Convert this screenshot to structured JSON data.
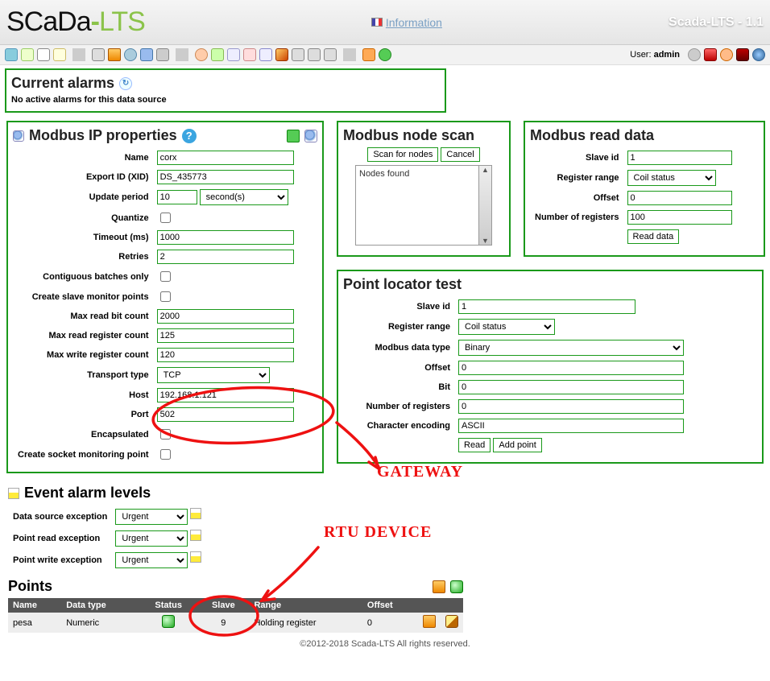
{
  "header": {
    "logo_pre": "SCaDa",
    "logo_post": "LTS",
    "info_link": "Information",
    "version": "Scada-LTS - 1.1",
    "user_label": "User:",
    "user_name": "admin"
  },
  "alarms": {
    "title": "Current alarms",
    "message": "No active alarms for this data source"
  },
  "modbus_props": {
    "title": "Modbus IP properties",
    "fields": {
      "name_l": "Name",
      "name_v": "corx",
      "xid_l": "Export ID (XID)",
      "xid_v": "DS_435773",
      "period_l": "Update period",
      "period_v": "10",
      "period_unit": "second(s)",
      "quantize_l": "Quantize",
      "timeout_l": "Timeout (ms)",
      "timeout_v": "1000",
      "retries_l": "Retries",
      "retries_v": "2",
      "cbatches_l": "Contiguous batches only",
      "csmp_l": "Create slave monitor points",
      "mrbit_l": "Max read bit count",
      "mrbit_v": "2000",
      "mrreg_l": "Max read register count",
      "mrreg_v": "125",
      "mwreg_l": "Max write register count",
      "mwreg_v": "120",
      "ttype_l": "Transport type",
      "ttype_v": "TCP",
      "host_l": "Host",
      "host_v": "192.168.1.121",
      "port_l": "Port",
      "port_v": "502",
      "encap_l": "Encapsulated",
      "csmon_l": "Create socket monitoring point"
    }
  },
  "node_scan": {
    "title": "Modbus node scan",
    "scan_btn": "Scan for nodes",
    "cancel_btn": "Cancel",
    "found": "Nodes found"
  },
  "read_data": {
    "title": "Modbus read data",
    "slave_l": "Slave id",
    "slave_v": "1",
    "range_l": "Register range",
    "range_v": "Coil status",
    "offset_l": "Offset",
    "offset_v": "0",
    "nreg_l": "Number of registers",
    "nreg_v": "100",
    "read_btn": "Read data"
  },
  "ptest": {
    "title": "Point locator test",
    "slave_l": "Slave id",
    "slave_v": "1",
    "range_l": "Register range",
    "range_v": "Coil status",
    "dtype_l": "Modbus data type",
    "dtype_v": "Binary",
    "offset_l": "Offset",
    "offset_v": "0",
    "bit_l": "Bit",
    "bit_v": "0",
    "nreg_l": "Number of registers",
    "nreg_v": "0",
    "enc_l": "Character encoding",
    "enc_v": "ASCII",
    "read_btn": "Read",
    "add_btn": "Add point"
  },
  "alarm_levels": {
    "title": "Event alarm levels",
    "dse_l": "Data source exception",
    "dse_v": "Urgent",
    "pre_l": "Point read exception",
    "pre_v": "Urgent",
    "pwe_l": "Point write exception",
    "pwe_v": "Urgent"
  },
  "points": {
    "title": "Points",
    "headers": {
      "name": "Name",
      "dtype": "Data type",
      "status": "Status",
      "slave": "Slave",
      "range": "Range",
      "offset": "Offset"
    },
    "rows": [
      {
        "name": "pesa",
        "dtype": "Numeric",
        "slave": "9",
        "range": "Holding register",
        "offset": "0"
      }
    ]
  },
  "footer": "©2012-2018 Scada-LTS All rights reserved.",
  "annotations": {
    "gateway": "GATEWAY",
    "rtu": "RTU DEVICE"
  }
}
